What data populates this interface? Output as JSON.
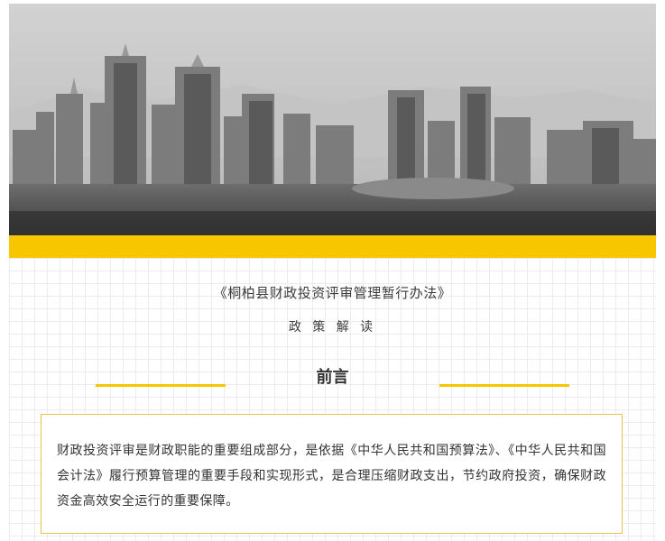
{
  "header": {
    "image_description": "city-skyline-photo",
    "band_color": "#f7c600"
  },
  "document": {
    "title": "《桐柏县财政投资评审管理暂行办法》",
    "subtitle": "政 策 解 读"
  },
  "section": {
    "heading": "前言",
    "accent_color": "#f7c600"
  },
  "intro": {
    "text": "财政投资评审是财政职能的重要组成部分，是依据《中华人民共和国预算法》、《中华人民共和国会计法》履行预算管理的重要手段和实现形式，是合理压缩财政支出，节约政府投资，确保财政资金高效安全运行的重要保障。"
  }
}
